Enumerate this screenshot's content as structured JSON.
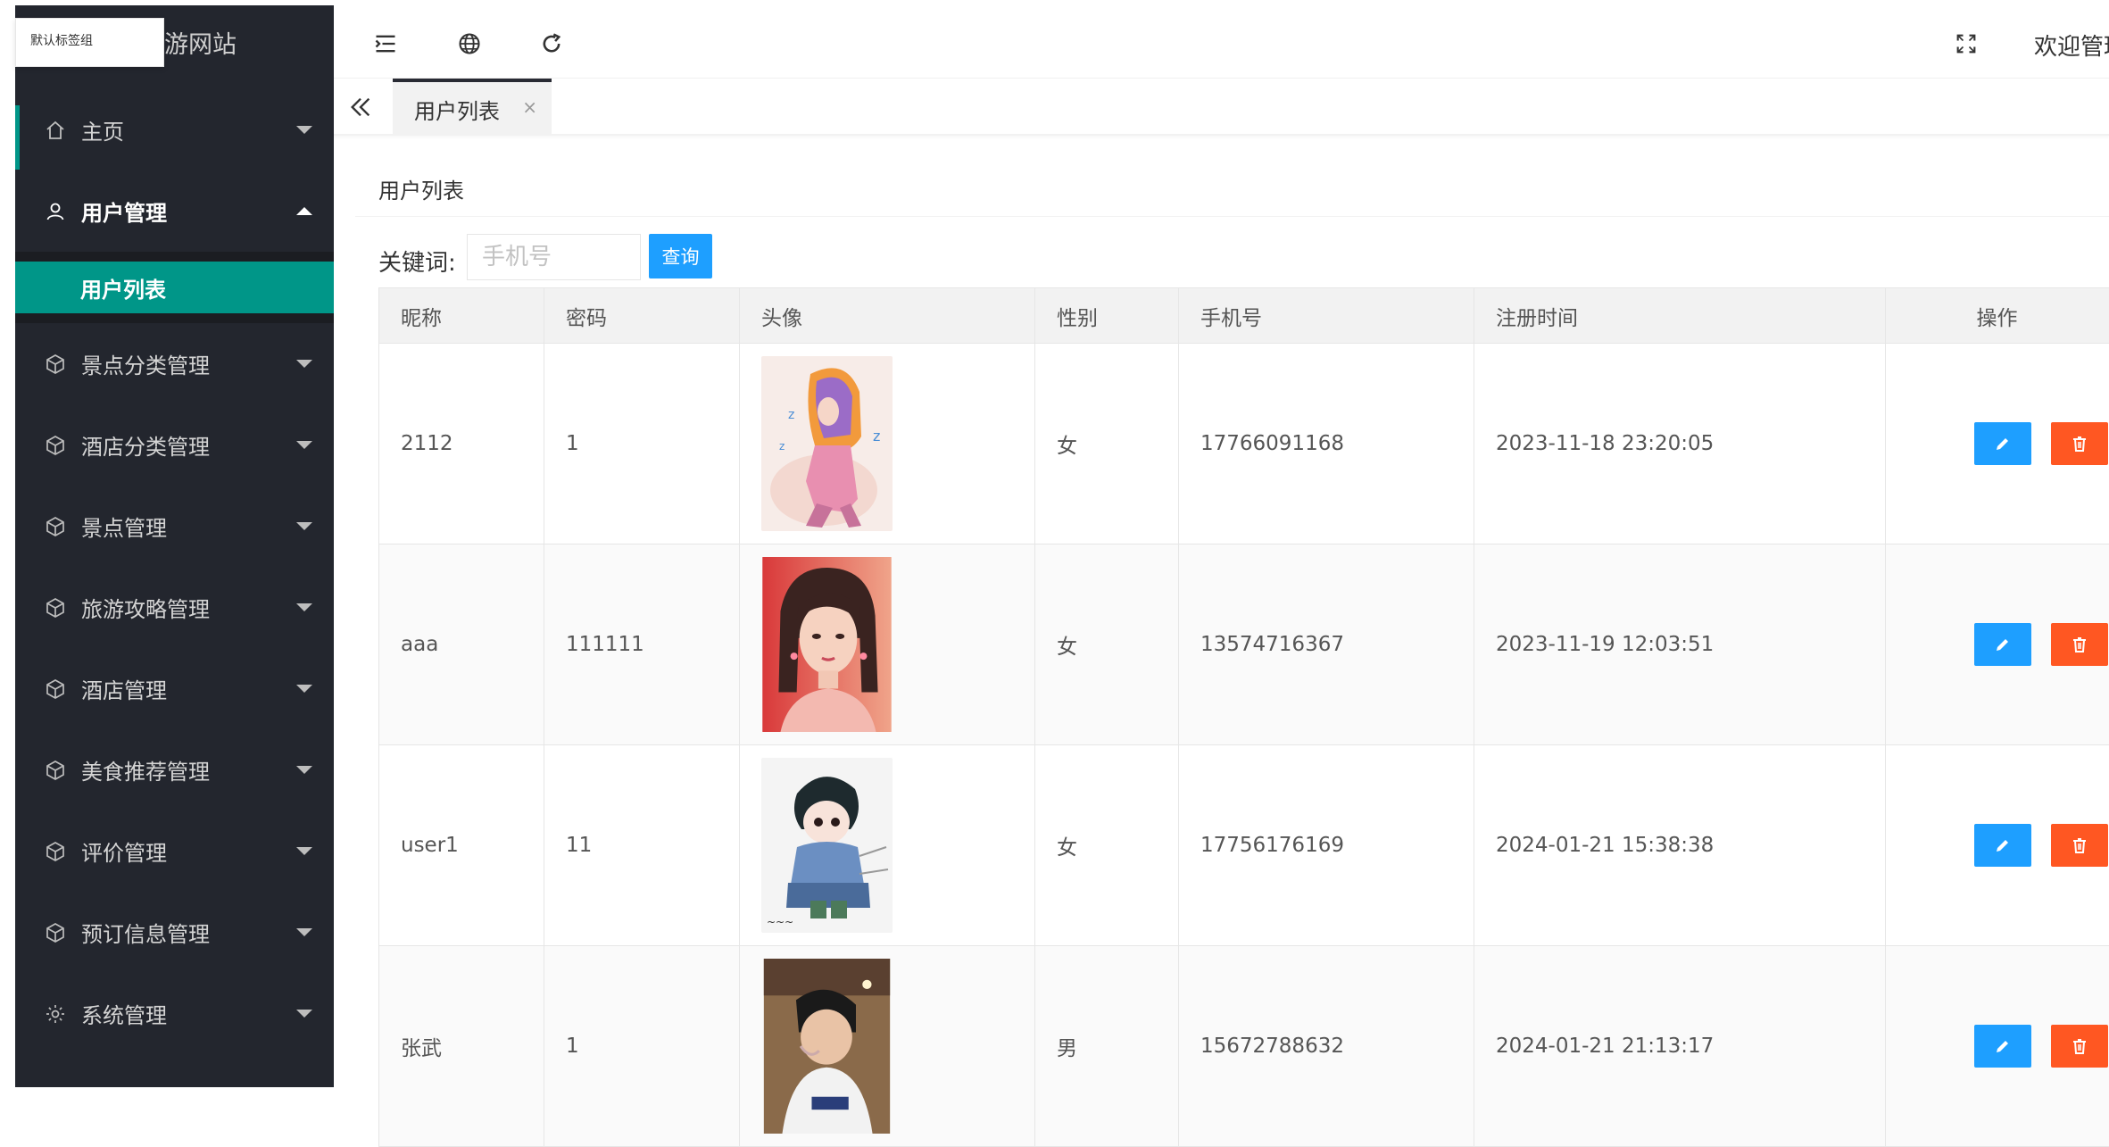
{
  "brand": {
    "title": "旅游网站",
    "popup_label": "默认标签组"
  },
  "sidebar": {
    "items": [
      {
        "label": "主页",
        "icon": "home-icon"
      },
      {
        "label": "用户管理",
        "icon": "user-icon"
      },
      {
        "label": "景点分类管理",
        "icon": "box-icon"
      },
      {
        "label": "酒店分类管理",
        "icon": "box-icon"
      },
      {
        "label": "景点管理",
        "icon": "box-icon"
      },
      {
        "label": "旅游攻略管理",
        "icon": "box-icon"
      },
      {
        "label": "酒店管理",
        "icon": "box-icon"
      },
      {
        "label": "美食推荐管理",
        "icon": "box-icon"
      },
      {
        "label": "评价管理",
        "icon": "box-icon"
      },
      {
        "label": "预订信息管理",
        "icon": "box-icon"
      },
      {
        "label": "系统管理",
        "icon": "gear-icon"
      }
    ],
    "submenu_active": "用户列表"
  },
  "header": {
    "welcome": "欢迎管理"
  },
  "tabs": [
    {
      "label": "用户列表",
      "close": "×"
    }
  ],
  "main": {
    "card_title": "用户列表",
    "search_label": "关键词:",
    "search_placeholder": "手机号",
    "search_button": "查询"
  },
  "table": {
    "headers": [
      "昵称",
      "密码",
      "头像",
      "性别",
      "手机号",
      "注册时间",
      "操作"
    ],
    "rows": [
      {
        "nickname": "2112",
        "password": "1",
        "gender": "女",
        "phone": "17766091168",
        "time": "2023-11-18 23:20:05"
      },
      {
        "nickname": "aaa",
        "password": "111111",
        "gender": "女",
        "phone": "13574716367",
        "time": "2023-11-19 12:03:51"
      },
      {
        "nickname": "user1",
        "password": "11",
        "gender": "女",
        "phone": "17756176169",
        "time": "2024-01-21 15:38:38"
      },
      {
        "nickname": "张武",
        "password": "1",
        "gender": "男",
        "phone": "15672788632",
        "time": "2024-01-21 21:13:17"
      }
    ]
  },
  "colors": {
    "sidebar_bg": "#23262e",
    "accent": "#009688",
    "primary": "#1e9fff",
    "danger": "#ff5722"
  }
}
